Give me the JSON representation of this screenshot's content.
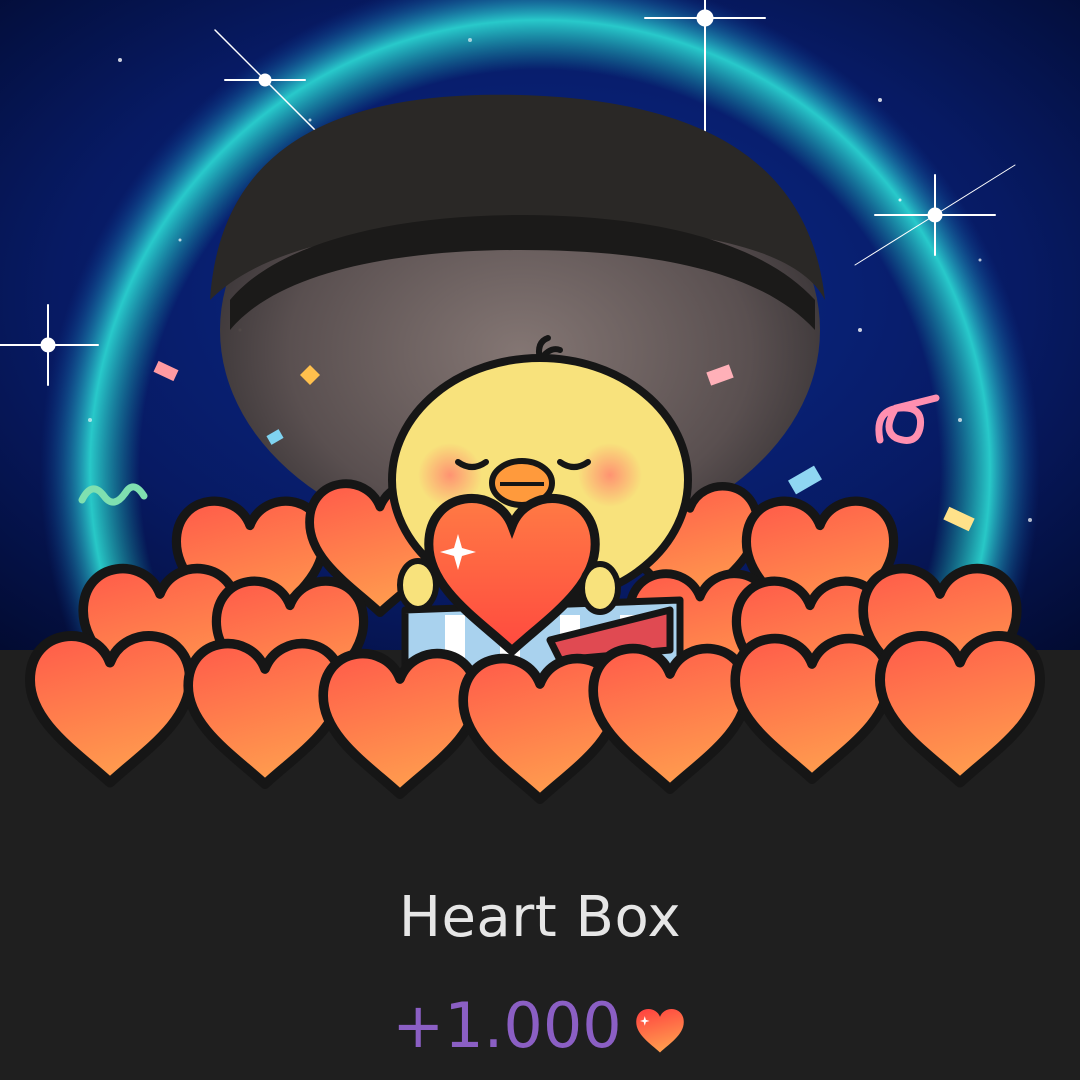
{
  "gift": {
    "name": "Heart Box",
    "amount": "+1.000",
    "currency_icon": "heart-icon"
  },
  "colors": {
    "panel_background": "#1f1f1f",
    "title_text": "#e6e6e6",
    "amount_text": "#8b5fc4",
    "heart_top": "#ff8a4a",
    "heart_bottom": "#ff3f3f",
    "sky": "#0a1f6b",
    "glow_ring": "#23d0c8",
    "chick": "#f8e27c"
  }
}
